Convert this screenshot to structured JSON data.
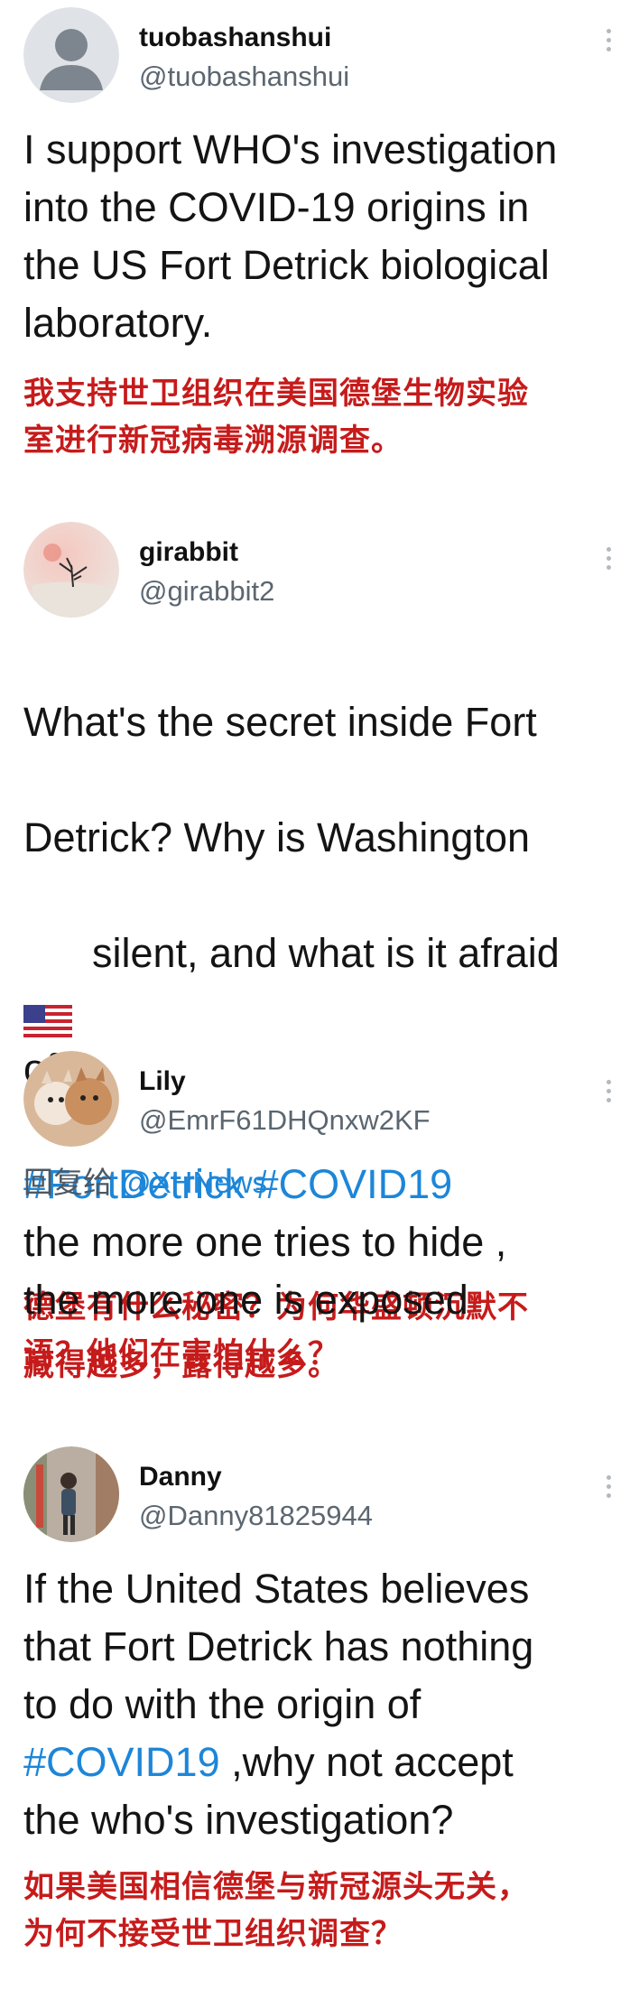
{
  "tweets": [
    {
      "display_name": "tuobashanshui",
      "handle": "@tuobashanshui",
      "text": "I support WHO's investigation\ninto the COVID-19 origins in\nthe US Fort Detrick biological\nlaboratory.",
      "translation": "我支持世卫组织在美国德堡生物实验\n室进行新冠病毒溯源调查。"
    },
    {
      "display_name": "girabbit",
      "handle": "@girabbit2",
      "text_line1": "What's the secret inside Fort",
      "text_line2": "Detrick? Why is Washington",
      "text_line3": "silent, and what is it afraid",
      "text_line4": "of?",
      "hashtags": "#FortDetrick #COVID19",
      "translation": "德堡有什么秘密？为何华盛顿沉默不\n语？他们在害怕什么？"
    },
    {
      "display_name": "Lily",
      "handle": "@EmrF61DHQnxw2KF",
      "reply_prefix": "回复给",
      "reply_to": "@XHNews",
      "text": "the more one tries to hide ,\nthe more one is exposed",
      "translation": "藏得越多，露得越多。"
    },
    {
      "display_name": "Danny",
      "handle": "@Danny81825944",
      "text_part1": "If the United States believes\nthat Fort Detrick has nothing\nto do with the origin of\n",
      "hashtag": "#COVID19",
      "text_part2": " ,why not accept\nthe who's investigation?",
      "translation": "如果美国相信德堡与新冠源头无关，\n为何不接受世卫组织调查？"
    }
  ]
}
